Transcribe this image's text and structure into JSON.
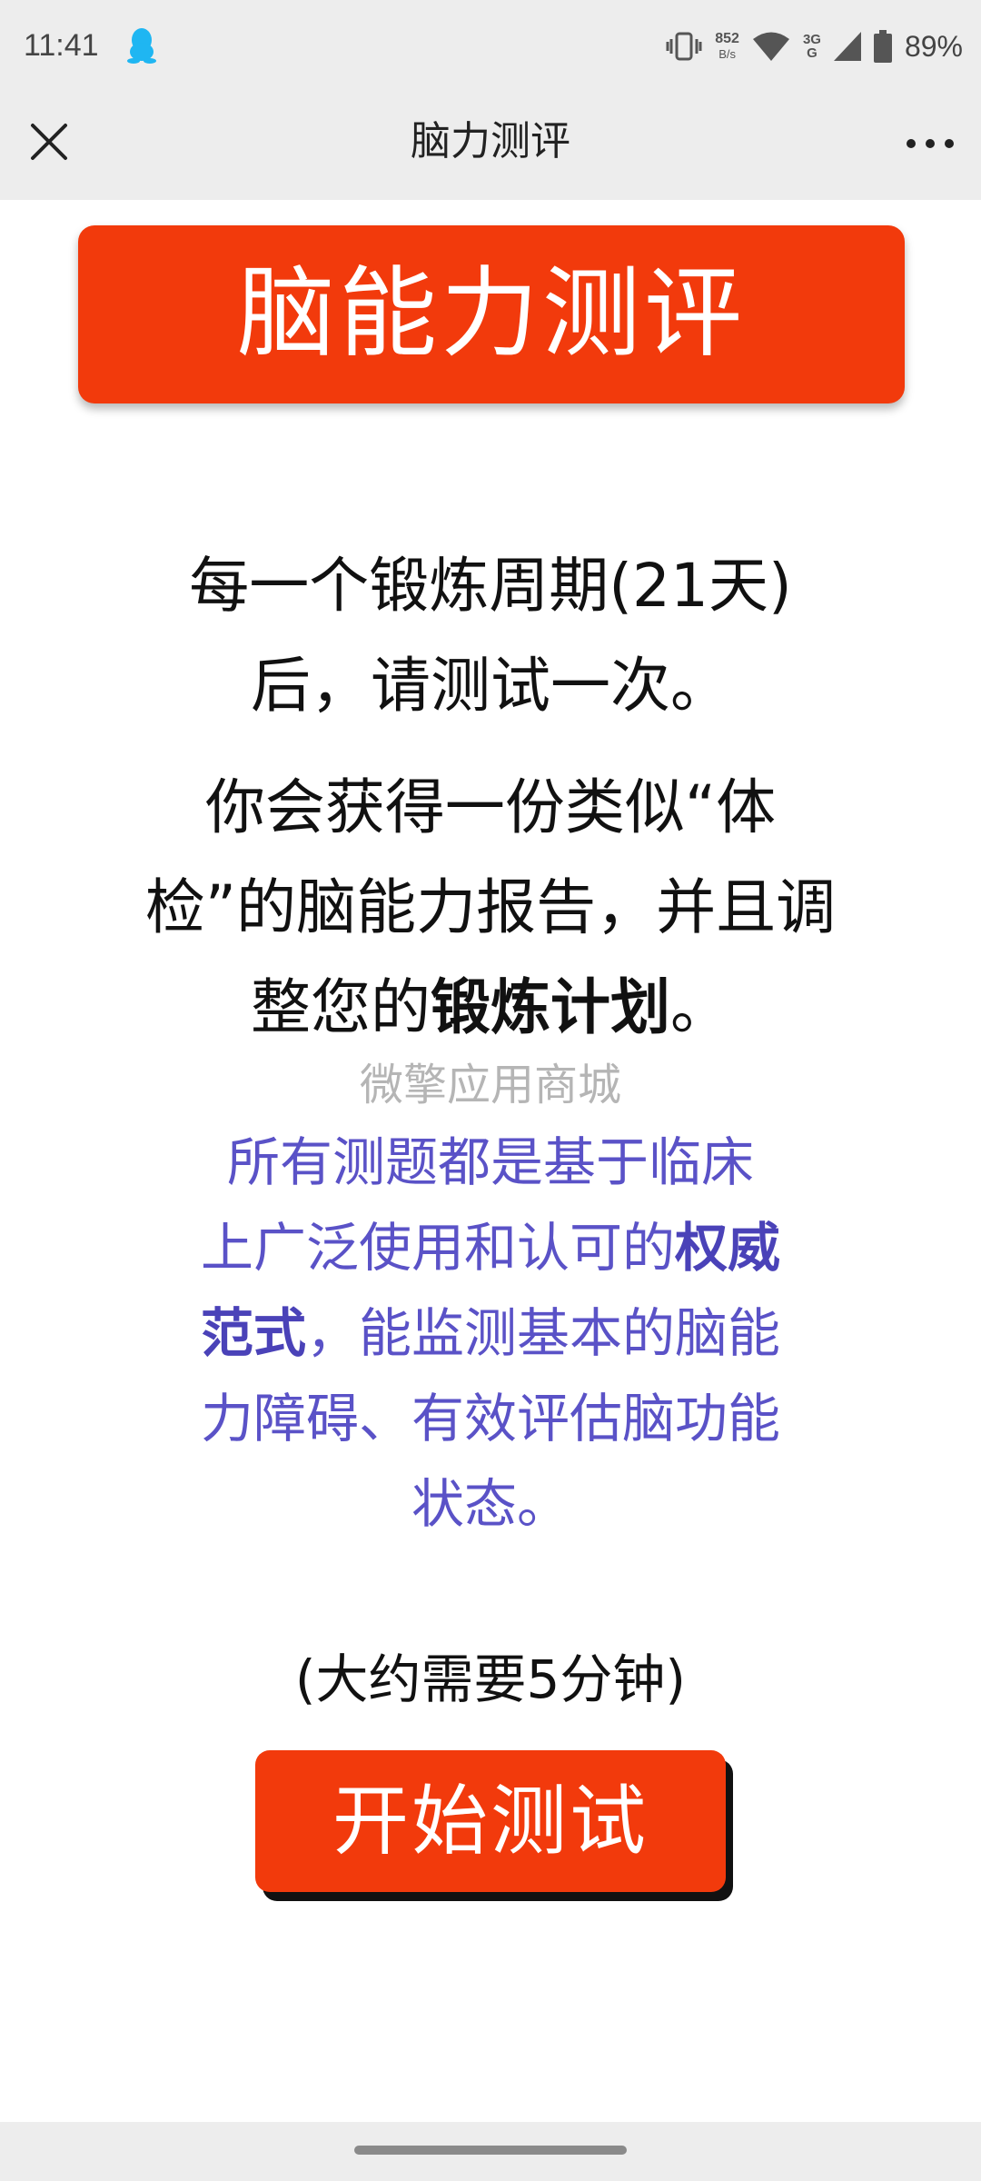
{
  "status_bar": {
    "time": "11:41",
    "net_speed_value": "852",
    "net_speed_unit": "B/s",
    "network_type_top": "3G",
    "network_type_bottom": "G",
    "battery": "89%",
    "icons": [
      "qq-icon",
      "vibrate-icon",
      "wifi-icon",
      "signal-icon",
      "battery-icon"
    ]
  },
  "nav": {
    "title": "脑力测评",
    "close_icon": "close-icon",
    "more_icon": "more-icon"
  },
  "content": {
    "banner_title": "脑能力测评",
    "para1_line1": "每一个锻炼周期(21天)",
    "para1_line2": "后，请测试一次。",
    "para2_line1": "你会获得一份类似“体",
    "para2_line2": "检”的脑能力报告，并且调",
    "para2_line3_prefix": "整您的",
    "para2_line3_bold": "锻炼计划",
    "para2_line3_suffix": "。",
    "watermark": "微擎应用商城",
    "para3_line1": "所有测题都是基于临床",
    "para3_line2_prefix": "上广泛使用和认可的",
    "para3_line2_bold": "权威",
    "para3_line3_bold": "范式",
    "para3_line3_suffix": "，能监测基本的脑能",
    "para3_line4": "力障碍、有效评估脑功能",
    "para3_line5": "状态。",
    "duration": "(大约需要5分钟)",
    "start_button": "开始测试"
  },
  "colors": {
    "accent_red": "#f23a0c",
    "purple_text": "#5a52c7",
    "watermark_gray": "#b5b5b5",
    "bar_gray": "#ededed"
  }
}
